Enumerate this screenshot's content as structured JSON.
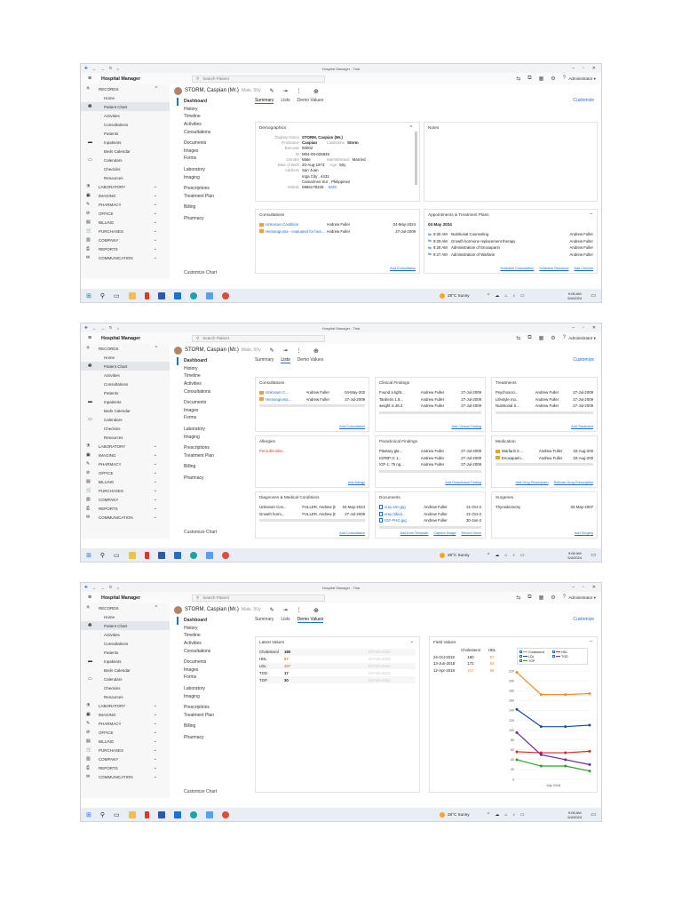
{
  "app": {
    "window_title": "Hospital Manager - Trial",
    "name": "Hospital Manager",
    "search_placeholder": "Search Patient",
    "user": "Administrator ▾"
  },
  "sidebar": {
    "top": [
      {
        "label": "RECORDS",
        "type": "header"
      },
      {
        "label": "Home"
      },
      {
        "label": "Patient Chart",
        "active": true
      },
      {
        "label": "Activities"
      },
      {
        "label": "Consultations"
      },
      {
        "label": "Patients"
      },
      {
        "label": "Inpatients"
      },
      {
        "label": "Beds Calendar"
      },
      {
        "label": "Calendars"
      },
      {
        "label": "Checkins"
      },
      {
        "label": "Resources"
      }
    ],
    "groups": [
      "LABORATORY",
      "IMAGING",
      "PHARMACY",
      "OFFICE",
      "BILLING",
      "PURCHASES",
      "COMPANY",
      "REPORTS",
      "COMMUNICATION"
    ]
  },
  "patient": {
    "name": "STORM, Caspian (Mr.)",
    "meta": "Male, 50y"
  },
  "dashboard_nav": {
    "groups": [
      [
        "Dashboard",
        "History",
        "Timeline",
        "Activities",
        "Consultations"
      ],
      [
        "Documents",
        "Images",
        "Forms"
      ],
      [
        "Laboratory",
        "Imaging"
      ],
      [
        "Prescriptions",
        "Treatment Plan"
      ],
      [
        "Billing"
      ],
      [
        "Pharmacy"
      ]
    ],
    "customize_chart": "Customize Chart"
  },
  "tabs": [
    "Summary",
    "Lists",
    "Demo Values"
  ],
  "customize": "Customize",
  "screen1": {
    "demographics": {
      "title": "Demographics",
      "fields": [
        {
          "k": "Display Name",
          "v": "STORM, Caspian (Mr.)"
        },
        {
          "k": "FirstName",
          "v": "Caspian",
          "k2": "LastName",
          "v2": "Storm"
        },
        {
          "k": "Barcode",
          "v": "00002"
        },
        {
          "k": "ID",
          "v": "M04-06-026845"
        },
        {
          "k": "Gender",
          "v": "Male",
          "k2": "MaritalStatus",
          "v2": "Married"
        },
        {
          "k": "Date of Birth",
          "v": "20-Aug-1973",
          "k2": "Age",
          "v2": "50y"
        },
        {
          "k": "Address",
          "v": "San Juan"
        },
        {
          "k": "",
          "v": "Iriga City , 4431"
        },
        {
          "k": "",
          "v": "Camarines Sur , Philippines"
        },
        {
          "k": "Mobile",
          "v": "0966178225",
          "v2": "SMS"
        }
      ]
    },
    "notes_title": "Notes",
    "consultations": {
      "title": "Consultations",
      "rows": [
        [
          "Unknown Condition",
          "Andrew Fuller",
          "04-May-2024"
        ],
        [
          "Hemangioma - evaluated for headache and",
          "Andrew Fuller",
          "27-Jul-2009"
        ]
      ],
      "link": "Add Consultation"
    },
    "appointments": {
      "title": "Appointments & Treatment Plans",
      "date": "04 May 2024",
      "rows": [
        [
          "9:30 AM",
          "Nutritional Counseling",
          "Andrew Fuller"
        ],
        [
          "9:29 AM",
          "Growth hormone replacement therapy",
          "Andrew Fuller"
        ],
        [
          "9:28 AM",
          "Administration of Enoxaparin",
          "Andrew Fuller"
        ],
        [
          "9:27 AM",
          "Administration of Warfarin",
          "Andrew Fuller"
        ]
      ],
      "links": [
        "Schedule Consultation",
        "Schedule Resource",
        "Add Checkin"
      ]
    }
  },
  "screen2": {
    "consultations": {
      "title": "Consultations",
      "rows": [
        [
          "Unknown C...",
          "Andrew Fuller",
          "04-May-202"
        ],
        [
          "Hemangiomа...",
          "Andrew Fuller",
          "27-Jul-2009"
        ]
      ],
      "link": "Add Consultation"
    },
    "clinical": {
      "title": "Clinical Findings",
      "rows": [
        [
          "Found a tight...",
          "Andrew Fuller",
          "27-Jul-2009"
        ],
        [
          "Tanberis 1.8...",
          "Andrew Fuller",
          "27-Jul-2009"
        ],
        [
          "weight is 48.3",
          "Andrew Fuller",
          "27-Jul-2009"
        ]
      ],
      "link": "Add Clinical Finding"
    },
    "treatments": {
      "title": "Treatments",
      "rows": [
        [
          "Psychosoci...",
          "Andrew Fuller",
          "27-Jul-2009"
        ],
        [
          "Lifestyle mo...",
          "Andrew Fuller",
          "27-Jul-2009"
        ],
        [
          "Nutritional S...",
          "Andrew Fuller",
          "27-Jul-2009"
        ]
      ],
      "link": "Add Treatment"
    },
    "allergies": {
      "title": "Allergies",
      "rows": [
        [
          "Penicillin aller...",
          "",
          ""
        ]
      ],
      "link": "Add Allergy"
    },
    "paraclinical": {
      "title": "Paraclinical Findings",
      "rows": [
        [
          "Pituitary gla...",
          "Andrew Fuller",
          "27-Jul-2009"
        ],
        [
          "IGFBP-3: 1...",
          "Andrew Fuller",
          "27-Jul-2009"
        ],
        [
          "IGF-1: 75 ng...",
          "Andrew Fuller",
          "27-Jul-2009"
        ]
      ],
      "link": "Add Paraclinical Finding"
    },
    "medication": {
      "title": "Medication",
      "rows": [
        [
          "Warfarin 5 ...",
          "Andrew Fuller",
          "02-Aug-200"
        ],
        [
          "Enoxaparin...",
          "Andrew Fuller",
          "02-Aug-200"
        ]
      ],
      "links": [
        "Add Drug Prescription",
        "Release Drug Prescription"
      ]
    },
    "diagnoses": {
      "title": "Diagnoses & Medical Conditions",
      "rows": [
        [
          "Unknown Con...",
          "FULLER, Andrew (Dr.)",
          "04-May-2024"
        ],
        [
          "Growth horm...",
          "FULLER, Andrew (Dr.)",
          "27-Jul-2009"
        ]
      ],
      "link": "Add Consultation"
    },
    "documents": {
      "title": "Documents",
      "rows": [
        [
          "xray arm.jpg",
          "Andrew Fuller",
          "21-Oct-2"
        ],
        [
          "xray (tibia)...",
          "Andrew Fuller",
          "21-Oct-2"
        ],
        [
          "IGF-FHG.jpg",
          "Andrew Fuller",
          "30-Jan-2"
        ]
      ],
      "links": [
        "Add from Template",
        "Capture Image",
        "Record Voice"
      ]
    },
    "surgeries": {
      "title": "Surgeries",
      "rows": [
        [
          "Thyroidectomy",
          "",
          "02-May-2007"
        ]
      ],
      "link": "Add Surgery"
    }
  },
  "screen3": {
    "latest_values": {
      "title": "Latest Values",
      "rows": [
        {
          "k": "Cholesterol",
          "v": "180",
          "c": "normal",
          "d": "04-Feb-2024"
        },
        {
          "k": "HDL",
          "v": "57",
          "c": "orange",
          "d": "04-Feb-2024"
        },
        {
          "k": "LDL",
          "v": "107",
          "c": "orange",
          "d": "04-Feb-2024"
        },
        {
          "k": "TGD",
          "v": "17",
          "c": "normal",
          "d": "04-Feb-2024"
        },
        {
          "k": "TGP",
          "v": "30",
          "c": "normal",
          "d": "04-Feb-2024"
        }
      ]
    },
    "field_values": {
      "title": "Field Values",
      "headers": [
        "",
        "Cholesterol",
        "HDL"
      ],
      "rows": [
        [
          "24-Oct-2018",
          "180",
          "57"
        ],
        [
          "13-Jun-2018",
          "172",
          "54"
        ],
        [
          "12-Apr-2018",
          "217",
          "56"
        ]
      ]
    },
    "chart_data": {
      "type": "line",
      "x": [
        "1",
        "2",
        "3",
        "4"
      ],
      "xlabel": "July 2018",
      "ylim": [
        0,
        220
      ],
      "yticks": [
        0,
        20,
        40,
        60,
        80,
        100,
        120,
        140,
        160,
        180,
        200,
        220
      ],
      "legend_position": "top-right",
      "series": [
        {
          "name": "Cholesterol",
          "color": "#f28e2b",
          "values": [
            217,
            172,
            172,
            174
          ]
        },
        {
          "name": "HDL",
          "color": "#d62728",
          "values": [
            56,
            54,
            54,
            57
          ]
        },
        {
          "name": "LDL",
          "color": "#1f4e99",
          "values": [
            142,
            107,
            107,
            110
          ]
        },
        {
          "name": "TGD",
          "color": "#6a2c91",
          "values": [
            95,
            50,
            40,
            30
          ]
        },
        {
          "name": "TGP",
          "color": "#2ca02c",
          "values": [
            40,
            27,
            27,
            17
          ]
        }
      ]
    }
  },
  "taskbar": {
    "weather": "28°C  Sunny",
    "time": "9:08 AM",
    "date": "5/4/2024"
  }
}
